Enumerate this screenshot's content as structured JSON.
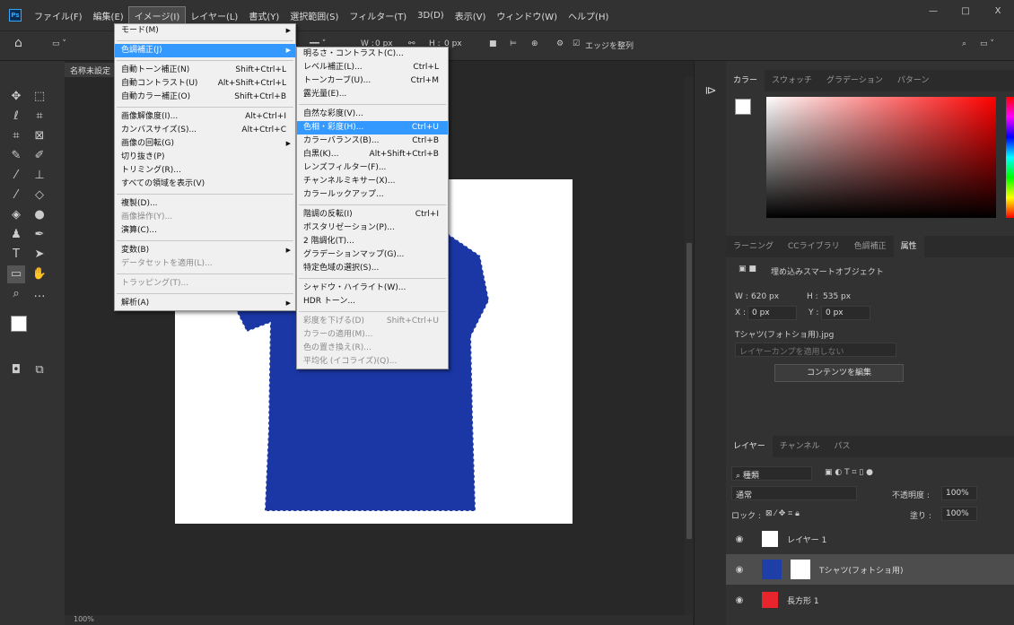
{
  "menubar": {
    "items": [
      "ファイル(F)",
      "編集(E)",
      "イメージ(I)",
      "レイヤー(L)",
      "書式(Y)",
      "選択範囲(S)",
      "フィルター(T)",
      "3D(D)",
      "表示(V)",
      "ウィンドウ(W)",
      "ヘルプ(H)"
    ]
  },
  "window": {
    "minimize": "—",
    "maximize": "□",
    "close": "X"
  },
  "options_bar": {
    "w_label": "W :",
    "w_value": "0 px",
    "h_label": "H :",
    "h_value": "0 px",
    "edge_align": "エッジを整列"
  },
  "document": {
    "tab_title": "名称未設定",
    "status_zoom": "100%"
  },
  "image_menu": {
    "items": [
      {
        "label": "モード(M)",
        "submenu": true
      },
      {
        "sep": true
      },
      {
        "label": "色調補正(J)",
        "submenu": true,
        "highlight": true
      },
      {
        "sep": true
      },
      {
        "label": "自動トーン補正(N)",
        "shortcut": "Shift+Ctrl+L"
      },
      {
        "label": "自動コントラスト(U)",
        "shortcut": "Alt+Shift+Ctrl+L"
      },
      {
        "label": "自動カラー補正(O)",
        "shortcut": "Shift+Ctrl+B"
      },
      {
        "sep": true
      },
      {
        "label": "画像解像度(I)...",
        "shortcut": "Alt+Ctrl+I"
      },
      {
        "label": "カンバスサイズ(S)...",
        "shortcut": "Alt+Ctrl+C"
      },
      {
        "label": "画像の回転(G)",
        "submenu": true
      },
      {
        "label": "切り抜き(P)"
      },
      {
        "label": "トリミング(R)..."
      },
      {
        "label": "すべての領域を表示(V)"
      },
      {
        "sep": true
      },
      {
        "label": "複製(D)..."
      },
      {
        "label": "画像操作(Y)...",
        "disabled": true
      },
      {
        "label": "演算(C)..."
      },
      {
        "sep": true
      },
      {
        "label": "変数(B)",
        "submenu": true
      },
      {
        "label": "データセットを適用(L)...",
        "disabled": true
      },
      {
        "sep": true
      },
      {
        "label": "トラッピング(T)...",
        "disabled": true
      },
      {
        "sep": true
      },
      {
        "label": "解析(A)",
        "submenu": true
      }
    ]
  },
  "adjust_menu": {
    "items": [
      {
        "label": "明るさ・コントラスト(C)..."
      },
      {
        "label": "レベル補正(L)...",
        "shortcut": "Ctrl+L"
      },
      {
        "label": "トーンカーブ(U)...",
        "shortcut": "Ctrl+M"
      },
      {
        "label": "露光量(E)..."
      },
      {
        "sep": true
      },
      {
        "label": "自然な彩度(V)..."
      },
      {
        "label": "色相・彩度(H)...",
        "shortcut": "Ctrl+U",
        "highlight": true
      },
      {
        "label": "カラーバランス(B)...",
        "shortcut": "Ctrl+B"
      },
      {
        "label": "白黒(K)...",
        "shortcut": "Alt+Shift+Ctrl+B"
      },
      {
        "label": "レンズフィルター(F)..."
      },
      {
        "label": "チャンネルミキサー(X)..."
      },
      {
        "label": "カラールックアップ..."
      },
      {
        "sep": true
      },
      {
        "label": "階調の反転(I)",
        "shortcut": "Ctrl+I"
      },
      {
        "label": "ポスタリゼーション(P)..."
      },
      {
        "label": "2 階調化(T)..."
      },
      {
        "label": "グラデーションマップ(G)..."
      },
      {
        "label": "特定色域の選択(S)..."
      },
      {
        "sep": true
      },
      {
        "label": "シャドウ・ハイライト(W)..."
      },
      {
        "label": "HDR トーン..."
      },
      {
        "sep": true
      },
      {
        "label": "彩度を下げる(D)",
        "shortcut": "Shift+Ctrl+U",
        "disabled": true
      },
      {
        "label": "カラーの適用(M)...",
        "disabled": true
      },
      {
        "label": "色の置き換え(R)...",
        "disabled": true
      },
      {
        "label": "平均化 (イコライズ)(Q)...",
        "disabled": true
      }
    ]
  },
  "color_panel": {
    "tabs": [
      "カラー",
      "スウォッチ",
      "グラデーション",
      "パターン"
    ]
  },
  "properties_panel": {
    "tabs": [
      "ラーニング",
      "CCライブラリ",
      "色調補正",
      "属性"
    ],
    "type_label": "埋め込みスマートオブジェクト",
    "w_label": "W :",
    "w_value": "620 px",
    "h_label": "H :",
    "h_value": "535 px",
    "x_label": "X :",
    "x_value": "0 px",
    "y_label": "Y :",
    "y_value": "0 px",
    "filename": "Tシャツ(フォトショ用).jpg",
    "layer_comp": "レイヤーカンプを適用しない",
    "edit_button": "コンテンツを編集"
  },
  "layers_panel": {
    "tabs": [
      "レイヤー",
      "チャンネル",
      "パス"
    ],
    "filter_kind": "種類",
    "blend_mode": "通常",
    "opacity_label": "不透明度 :",
    "opacity_value": "100%",
    "lock_label": "ロック :",
    "fill_label": "塗り :",
    "fill_value": "100%",
    "layers": [
      {
        "name": "レイヤー 1",
        "thumb_color": "#ffffff"
      },
      {
        "name": "Tシャツ(フォトショ用)",
        "thumb_color": "#1f3fa8",
        "selected": true
      },
      {
        "name": "長方形 1",
        "thumb_color": "#e8242c"
      }
    ]
  },
  "colors": {
    "shirt_blue": "#1b37a6",
    "menu_highlight": "#3399ff",
    "foreground": "#ffffff",
    "background": "#ffffff"
  }
}
